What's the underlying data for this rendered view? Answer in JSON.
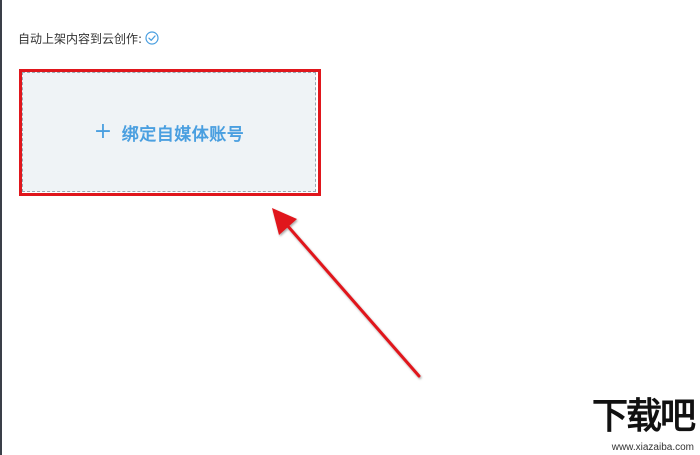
{
  "setting": {
    "label": "自动上架内容到云创作:",
    "status_icon": "check-circle-icon",
    "accent_color": "#4a9fe0"
  },
  "bind_card": {
    "plus": "+",
    "label": "绑定自媒体账号",
    "highlight_color": "#e0161c"
  },
  "watermark": {
    "brand": "下载吧",
    "url": "www.xiazaiba.com"
  }
}
